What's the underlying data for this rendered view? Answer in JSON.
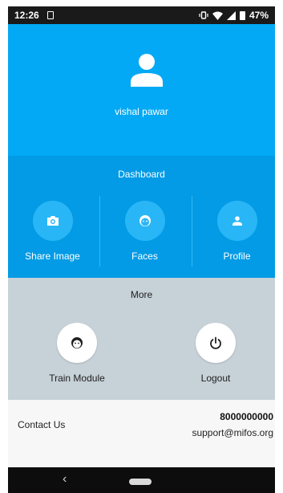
{
  "status_bar": {
    "time": "12:26",
    "battery": "47%"
  },
  "header": {
    "user_name": "vishal pawar",
    "avatar_icon": "person-icon",
    "background": "#03a9f4"
  },
  "dashboard": {
    "title": "Dashboard",
    "background": "#039be5",
    "items": [
      {
        "label": "Share Image",
        "icon": "camera-icon"
      },
      {
        "label": "Faces",
        "icon": "face-icon"
      },
      {
        "label": "Profile",
        "icon": "person-icon"
      }
    ]
  },
  "more": {
    "title": "More",
    "background": "#c7d1d8",
    "items": [
      {
        "label": "Train Module",
        "icon": "face-icon"
      },
      {
        "label": "Logout",
        "icon": "power-icon"
      }
    ]
  },
  "contact": {
    "label": "Contact Us",
    "phone": "8000000000",
    "email": "support@mifos.org"
  },
  "navigation": {
    "back_glyph": "‹"
  }
}
